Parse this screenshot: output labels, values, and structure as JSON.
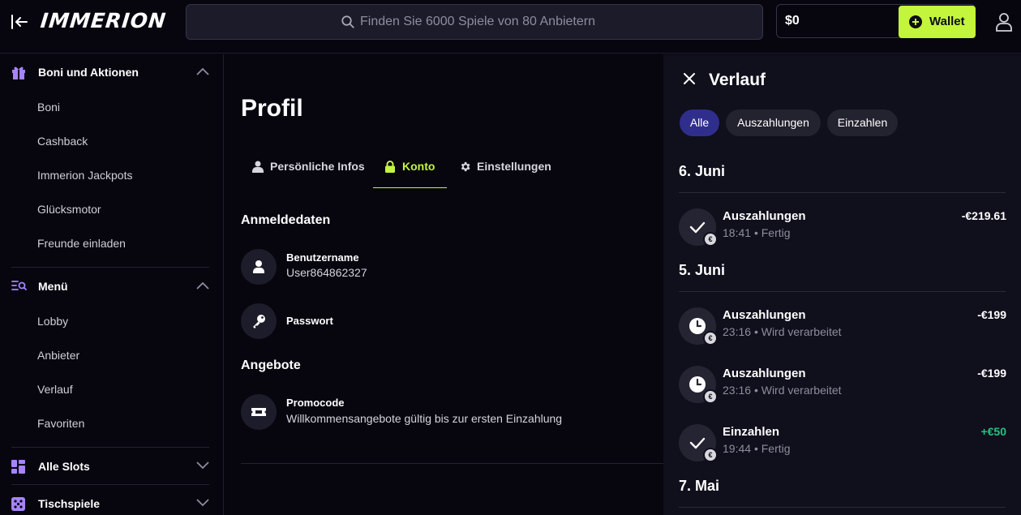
{
  "header": {
    "logo": "IMMERION",
    "search_placeholder": "Finden Sie 6000 Spiele von 80 Anbietern",
    "balance": "$0",
    "wallet_label": "Wallet"
  },
  "sidebar": {
    "sections": [
      {
        "label": "Boni und Aktionen",
        "icon": "gift-icon",
        "expanded": true,
        "items": [
          "Boni",
          "Cashback",
          "Immerion Jackpots",
          "Glücksmotor",
          "Freunde einladen"
        ]
      },
      {
        "label": "Menü",
        "icon": "menu-search-icon",
        "expanded": true,
        "items": [
          "Lobby",
          "Anbieter",
          "Verlauf",
          "Favoriten"
        ]
      },
      {
        "label": "Alle Slots",
        "icon": "grid-icon",
        "expanded": false,
        "items": []
      },
      {
        "label": "Tischspiele",
        "icon": "dice-icon",
        "expanded": false,
        "items": []
      }
    ]
  },
  "main": {
    "title": "Profil",
    "tabs": [
      {
        "label": "Persönliche Infos",
        "icon": "person-icon",
        "active": false
      },
      {
        "label": "Konto",
        "icon": "lock-icon",
        "active": true
      },
      {
        "label": "Einstellungen",
        "icon": "gear-icon",
        "active": false
      }
    ],
    "login_section": {
      "title": "Anmeldedaten",
      "username_label": "Benutzername",
      "username_value": "User864862327",
      "password_label": "Passwort"
    },
    "offers_section": {
      "title": "Angebote",
      "promo_label": "Promocode",
      "promo_value": "Willkommensangebote gültig bis zur ersten Einzahlung"
    }
  },
  "history": {
    "title": "Verlauf",
    "filters": [
      {
        "label": "Alle",
        "active": true
      },
      {
        "label": "Auszahlungen",
        "active": false
      },
      {
        "label": "Einzahlen",
        "active": false
      }
    ],
    "groups": [
      {
        "date": "6. Juni",
        "transactions": [
          {
            "type": "Auszahlungen",
            "time": "18:41",
            "status": "Fertig",
            "amount": "-€219.61",
            "status_icon": "check-icon"
          }
        ]
      },
      {
        "date": "5. Juni",
        "transactions": [
          {
            "type": "Auszahlungen",
            "time": "23:16",
            "status": "Wird verarbeitet",
            "amount": "-€199",
            "status_icon": "clock-icon"
          },
          {
            "type": "Auszahlungen",
            "time": "23:16",
            "status": "Wird verarbeitet",
            "amount": "-€199",
            "status_icon": "clock-icon"
          },
          {
            "type": "Einzahlen",
            "time": "19:44",
            "status": "Fertig",
            "amount": "+€50",
            "status_icon": "check-icon"
          }
        ]
      },
      {
        "date": "7. Mai",
        "transactions": []
      }
    ],
    "meta_separator": "•",
    "currency_symbol": "€",
    "positive_color": "#26c281"
  },
  "colors": {
    "accent": "#c3f53c",
    "active_chip": "#302e8c",
    "sidebar_icon": "#a684ff"
  }
}
